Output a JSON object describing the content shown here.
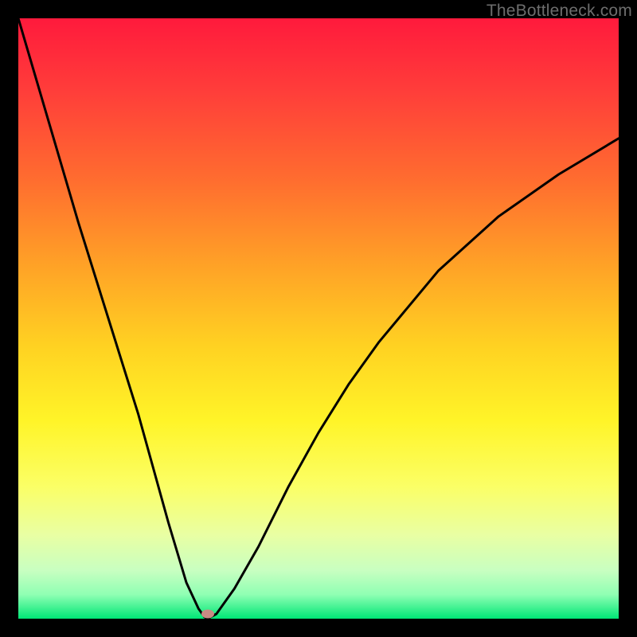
{
  "watermark": "TheBottleneck.com",
  "chart_data": {
    "type": "line",
    "title": "",
    "xlabel": "",
    "ylabel": "",
    "xlim": [
      0,
      1
    ],
    "ylim": [
      0,
      1
    ],
    "background_gradient": {
      "top_color": "#ff1a3c",
      "bottom_color": "#00e676",
      "note": "vertical gradient red→orange→yellow→green"
    },
    "series": [
      {
        "name": "bottleneck-curve",
        "color": "#000000",
        "x": [
          0.0,
          0.05,
          0.1,
          0.15,
          0.2,
          0.25,
          0.28,
          0.3,
          0.31,
          0.315,
          0.33,
          0.36,
          0.4,
          0.45,
          0.5,
          0.55,
          0.6,
          0.7,
          0.8,
          0.9,
          1.0
        ],
        "y": [
          1.0,
          0.83,
          0.66,
          0.5,
          0.34,
          0.16,
          0.06,
          0.017,
          0.003,
          0.0,
          0.008,
          0.05,
          0.12,
          0.22,
          0.31,
          0.39,
          0.46,
          0.58,
          0.67,
          0.74,
          0.8
        ],
        "note": "y is fraction of plot height measured from bottom (0) to top (1); curve dips to 0 near x≈0.315"
      }
    ],
    "marker": {
      "name": "bottleneck-minimum",
      "x": 0.315,
      "y": 0.008,
      "color": "#c98b84"
    },
    "grid": false,
    "legend": false,
    "annotations": []
  }
}
